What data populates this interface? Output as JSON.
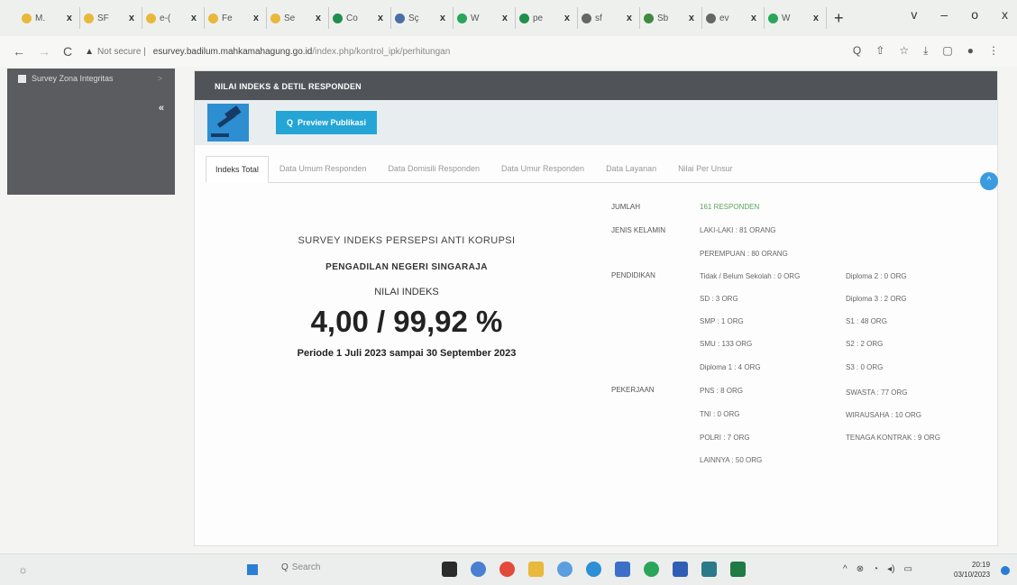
{
  "browser": {
    "tabs": [
      {
        "label": "M.",
        "color": "#e8b83a"
      },
      {
        "label": "SF",
        "color": "#e8b83a"
      },
      {
        "label": "e-(",
        "color": "#e8b83a"
      },
      {
        "label": "Fe",
        "color": "#e8b83a"
      },
      {
        "label": "Se",
        "color": "#e8b83a"
      },
      {
        "label": "Co",
        "color": "#1f8f4d"
      },
      {
        "label": "Sç",
        "color": "#4a6fa8"
      },
      {
        "label": "W",
        "color": "#2aa55a"
      },
      {
        "label": "pe",
        "color": "#1f8f4d"
      },
      {
        "label": "sf",
        "color": "#666666"
      },
      {
        "label": "Sb",
        "color": "#3f8a3f"
      },
      {
        "label": "ev",
        "color": "#666666"
      },
      {
        "label": "W",
        "color": "#2aa55a"
      }
    ],
    "tab_close": "x",
    "new_tab": "+",
    "window_controls": [
      "v",
      "–",
      "o",
      "x"
    ],
    "nav_back": "←",
    "nav_forward": "→",
    "nav_reload": "C",
    "warn_icon": "▲",
    "security_label": "Not secure",
    "url_domain": "esurvey.badilum.mahkamahagung.go.id",
    "url_path": "/index.php/kontrol_ipk/perhitungan"
  },
  "sidebar": {
    "item_label": "Survey Zona Integritas",
    "item_chevron": ">",
    "collapse_label": "«"
  },
  "panel": {
    "header": "NILAI INDEKS & DETIL RESPONDEN",
    "preview_label": "Preview Publikasi",
    "preview_icon": "Q",
    "scroll_icon": "^",
    "tabs": [
      "Indeks Total",
      "Data Umum Responden",
      "Data Domisili Responden",
      "Data Umur Responden",
      "Data Layanan",
      "Nilai Per Unsur"
    ],
    "active_tab": "Indeks Total"
  },
  "summary": {
    "survey_title": "SURVEY INDEKS PERSEPSI ANTI KORUPSI",
    "court": "PENGADILAN NEGERI SINGARAJA",
    "index_label": "NILAI INDEKS",
    "index_value": "4,00 / 99,92 %",
    "period": "Periode 1 Juli 2023 sampai 30 September 2023"
  },
  "details": {
    "jumlah_label": "JUMLAH",
    "jumlah_value": "161 RESPONDEN",
    "gender_label": "JENIS KELAMIN",
    "gender_male": "LAKI-LAKI : 81 ORANG",
    "gender_female": "PEREMPUAN : 80 ORANG",
    "edu_label": "PENDIDIKAN",
    "edu_col1": [
      "Tidak / Belum Sekolah : 0 ORG",
      "SD : 3 ORG",
      "SMP : 1 ORG",
      "SMU : 133 ORG",
      "Diploma 1 : 4 ORG"
    ],
    "edu_col2": [
      "Diploma 2 : 0 ORG",
      "Diploma 3 : 2 ORG",
      "S1 : 48 ORG",
      "S2 : 2 ORG",
      "S3 : 0 ORG"
    ],
    "job_label": "PEKERJAAN",
    "job_col1": [
      "PNS : 8 ORG",
      "TNI : 0 ORG",
      "POLRI : 7 ORG",
      "LAINNYA : 50 ORG"
    ],
    "job_col2": [
      "SWASTA : 77 ORG",
      "WIRAUSAHA : 10 ORG",
      "TENAGA KONTRAK : 9 ORG"
    ]
  },
  "taskbar": {
    "search_icon": "Q",
    "search_label": "Search",
    "tray": [
      "^",
      "⊗",
      "wifi",
      "vol",
      "bat"
    ],
    "time": "20:19",
    "date": "03/10/2023"
  }
}
